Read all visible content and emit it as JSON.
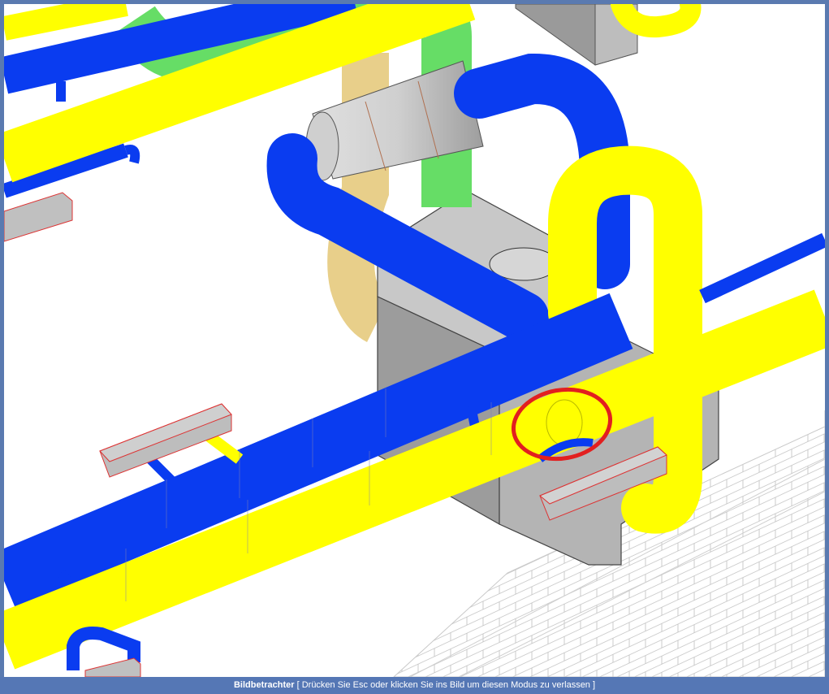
{
  "status_bar": {
    "mode_title": "Bildbetrachter",
    "hint": "[ Drücken Sie Esc oder klicken Sie ins Bild um diesen Modus zu verlassen ]"
  },
  "scene": {
    "pipe_colors": {
      "supply": "#0a3cf0",
      "return": "#ffff00",
      "secondary": "#66dd66",
      "tertiary": "#e8cf8a"
    },
    "equipment_color": "#a8a8a8",
    "highlight_color": "#e21f1f",
    "background": "#ffffff",
    "frame_color": "#5a7ab0"
  },
  "icons": {
    "highlight_marker": "red-circle-marker"
  }
}
